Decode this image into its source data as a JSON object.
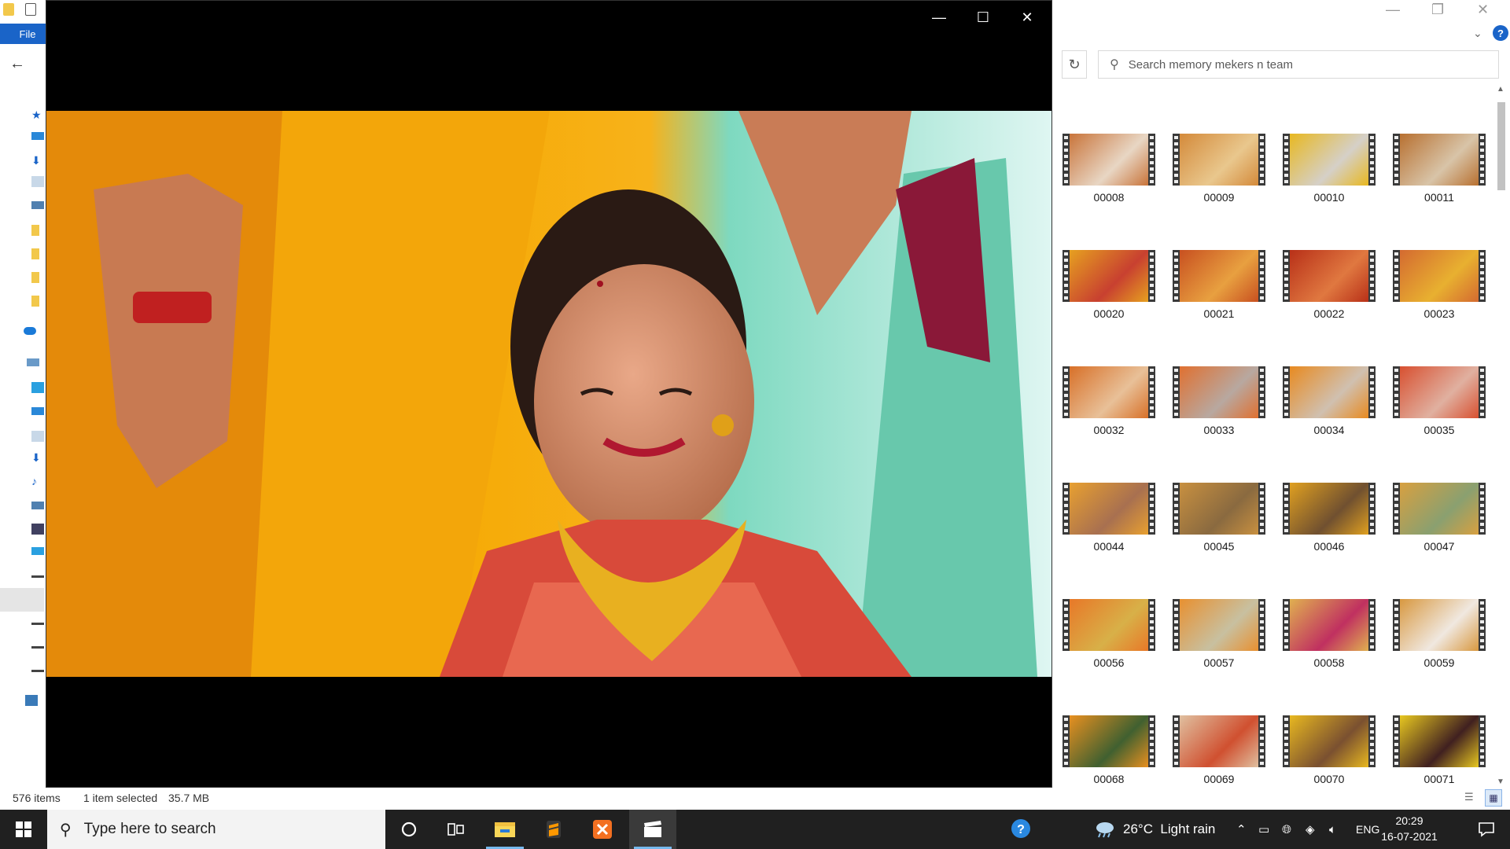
{
  "explorer": {
    "file_tab": "File",
    "search_placeholder": "Search memory mekers n team",
    "thumbnails": [
      {
        "label": "00008",
        "c1": "#c9743a",
        "c2": "#e8d6c4"
      },
      {
        "label": "00009",
        "c1": "#d48a3a",
        "c2": "#e9c78d"
      },
      {
        "label": "00010",
        "c1": "#e8b820",
        "c2": "#d5d0c8"
      },
      {
        "label": "00011",
        "c1": "#b87030",
        "c2": "#d8c4a8"
      },
      {
        "label": "00020",
        "c1": "#e6a020",
        "c2": "#c84030"
      },
      {
        "label": "00021",
        "c1": "#c85020",
        "c2": "#e8a040"
      },
      {
        "label": "00022",
        "c1": "#b83018",
        "c2": "#e07840"
      },
      {
        "label": "00023",
        "c1": "#d46a30",
        "c2": "#e8b030"
      },
      {
        "label": "00032",
        "c1": "#d87028",
        "c2": "#e8c098"
      },
      {
        "label": "00033",
        "c1": "#e07030",
        "c2": "#b8a8a0"
      },
      {
        "label": "00034",
        "c1": "#e88a20",
        "c2": "#d0c0b0"
      },
      {
        "label": "00035",
        "c1": "#d85030",
        "c2": "#e0b0a0"
      },
      {
        "label": "00044",
        "c1": "#e8a030",
        "c2": "#a87050"
      },
      {
        "label": "00045",
        "c1": "#c89040",
        "c2": "#8a6a40"
      },
      {
        "label": "00046",
        "c1": "#e0a020",
        "c2": "#705030"
      },
      {
        "label": "00047",
        "c1": "#d8a040",
        "c2": "#8aa070"
      },
      {
        "label": "00056",
        "c1": "#e87828",
        "c2": "#d8b048"
      },
      {
        "label": "00057",
        "c1": "#e89030",
        "c2": "#c8c0a0"
      },
      {
        "label": "00058",
        "c1": "#e0b050",
        "c2": "#c03060"
      },
      {
        "label": "00059",
        "c1": "#d89840",
        "c2": "#f0e8e0"
      },
      {
        "label": "00068",
        "c1": "#e89020",
        "c2": "#406030"
      },
      {
        "label": "00069",
        "c1": "#e0c0a0",
        "c2": "#d05030"
      },
      {
        "label": "00070",
        "c1": "#e8b820",
        "c2": "#7a5030"
      },
      {
        "label": "00071",
        "c1": "#e8c820",
        "c2": "#402020"
      }
    ],
    "status": {
      "items_count": "576 items",
      "selection": "1 item selected",
      "size": "35.7 MB"
    }
  },
  "taskbar": {
    "search_placeholder": "Type here to search",
    "weather": "26°C  Light rain",
    "language": "ENG",
    "time": "20:29",
    "date": "16-07-2021"
  },
  "colors": {
    "accent": "#1a64c8",
    "taskbar": "#202020",
    "active_indicator": "#76b9ed"
  }
}
